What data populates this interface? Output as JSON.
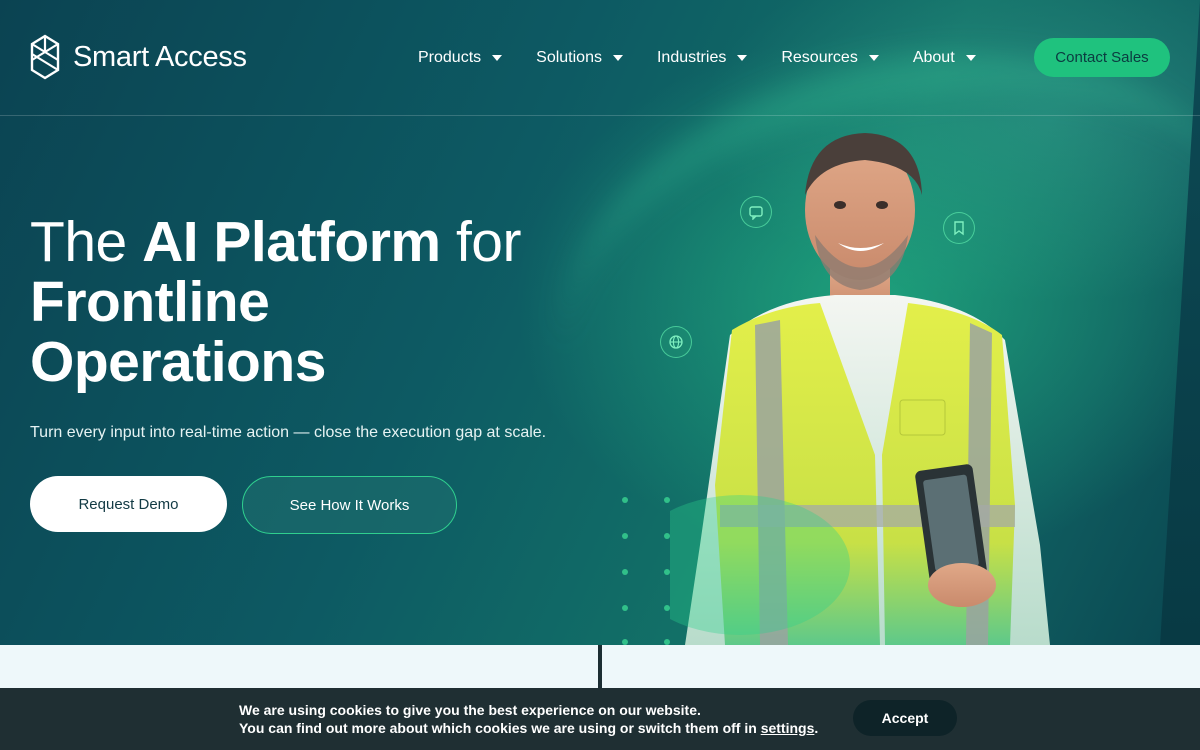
{
  "brand": {
    "name": "Smart Access"
  },
  "nav": {
    "items": [
      {
        "label": "Products"
      },
      {
        "label": "Solutions"
      },
      {
        "label": "Industries"
      },
      {
        "label": "Resources"
      },
      {
        "label": "About"
      }
    ],
    "contact_label": "Contact Sales"
  },
  "hero": {
    "headline_part1": "The ",
    "headline_bold1": "AI Platform",
    "headline_part2": " for",
    "headline_bold2": "Frontline",
    "headline_bold3": "Operations",
    "subline": "Turn every input into real-time action — close the execution gap at scale.",
    "primary_cta": "Request Demo",
    "secondary_cta": "See How It Works"
  },
  "cookie": {
    "line1": "We are using cookies to give you the best experience on our website.",
    "line2_prefix": "You can find out more about which cookies we are using or switch them off in ",
    "line2_link": "settings",
    "line2_suffix": ".",
    "accept_label": "Accept"
  },
  "colors": {
    "accent": "#1fc27e",
    "hero_bg": "#0d5a63",
    "cookie_bg": "#1f2f33"
  },
  "icons": [
    "logo-mark-icon",
    "chevron-down-icon",
    "chat-icon",
    "bookmark-icon",
    "globe-icon"
  ]
}
